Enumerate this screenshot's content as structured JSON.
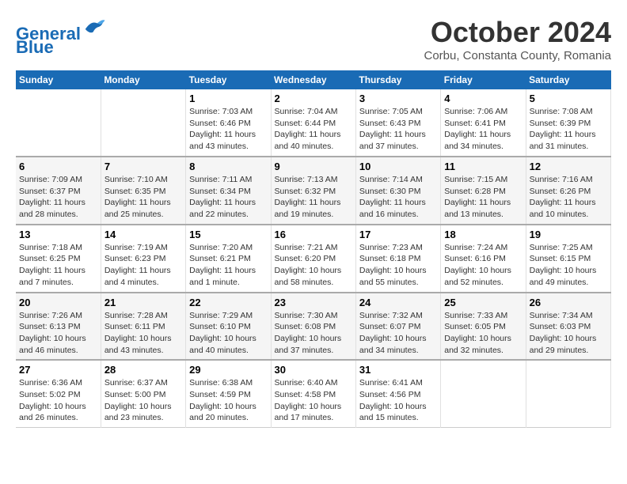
{
  "header": {
    "logo_line1": "General",
    "logo_line2": "Blue",
    "month": "October 2024",
    "location": "Corbu, Constanta County, Romania"
  },
  "columns": [
    "Sunday",
    "Monday",
    "Tuesday",
    "Wednesday",
    "Thursday",
    "Friday",
    "Saturday"
  ],
  "weeks": [
    [
      {
        "day": "",
        "info": ""
      },
      {
        "day": "",
        "info": ""
      },
      {
        "day": "1",
        "info": "Sunrise: 7:03 AM\nSunset: 6:46 PM\nDaylight: 11 hours and 43 minutes."
      },
      {
        "day": "2",
        "info": "Sunrise: 7:04 AM\nSunset: 6:44 PM\nDaylight: 11 hours and 40 minutes."
      },
      {
        "day": "3",
        "info": "Sunrise: 7:05 AM\nSunset: 6:43 PM\nDaylight: 11 hours and 37 minutes."
      },
      {
        "day": "4",
        "info": "Sunrise: 7:06 AM\nSunset: 6:41 PM\nDaylight: 11 hours and 34 minutes."
      },
      {
        "day": "5",
        "info": "Sunrise: 7:08 AM\nSunset: 6:39 PM\nDaylight: 11 hours and 31 minutes."
      }
    ],
    [
      {
        "day": "6",
        "info": "Sunrise: 7:09 AM\nSunset: 6:37 PM\nDaylight: 11 hours and 28 minutes."
      },
      {
        "day": "7",
        "info": "Sunrise: 7:10 AM\nSunset: 6:35 PM\nDaylight: 11 hours and 25 minutes."
      },
      {
        "day": "8",
        "info": "Sunrise: 7:11 AM\nSunset: 6:34 PM\nDaylight: 11 hours and 22 minutes."
      },
      {
        "day": "9",
        "info": "Sunrise: 7:13 AM\nSunset: 6:32 PM\nDaylight: 11 hours and 19 minutes."
      },
      {
        "day": "10",
        "info": "Sunrise: 7:14 AM\nSunset: 6:30 PM\nDaylight: 11 hours and 16 minutes."
      },
      {
        "day": "11",
        "info": "Sunrise: 7:15 AM\nSunset: 6:28 PM\nDaylight: 11 hours and 13 minutes."
      },
      {
        "day": "12",
        "info": "Sunrise: 7:16 AM\nSunset: 6:26 PM\nDaylight: 11 hours and 10 minutes."
      }
    ],
    [
      {
        "day": "13",
        "info": "Sunrise: 7:18 AM\nSunset: 6:25 PM\nDaylight: 11 hours and 7 minutes."
      },
      {
        "day": "14",
        "info": "Sunrise: 7:19 AM\nSunset: 6:23 PM\nDaylight: 11 hours and 4 minutes."
      },
      {
        "day": "15",
        "info": "Sunrise: 7:20 AM\nSunset: 6:21 PM\nDaylight: 11 hours and 1 minute."
      },
      {
        "day": "16",
        "info": "Sunrise: 7:21 AM\nSunset: 6:20 PM\nDaylight: 10 hours and 58 minutes."
      },
      {
        "day": "17",
        "info": "Sunrise: 7:23 AM\nSunset: 6:18 PM\nDaylight: 10 hours and 55 minutes."
      },
      {
        "day": "18",
        "info": "Sunrise: 7:24 AM\nSunset: 6:16 PM\nDaylight: 10 hours and 52 minutes."
      },
      {
        "day": "19",
        "info": "Sunrise: 7:25 AM\nSunset: 6:15 PM\nDaylight: 10 hours and 49 minutes."
      }
    ],
    [
      {
        "day": "20",
        "info": "Sunrise: 7:26 AM\nSunset: 6:13 PM\nDaylight: 10 hours and 46 minutes."
      },
      {
        "day": "21",
        "info": "Sunrise: 7:28 AM\nSunset: 6:11 PM\nDaylight: 10 hours and 43 minutes."
      },
      {
        "day": "22",
        "info": "Sunrise: 7:29 AM\nSunset: 6:10 PM\nDaylight: 10 hours and 40 minutes."
      },
      {
        "day": "23",
        "info": "Sunrise: 7:30 AM\nSunset: 6:08 PM\nDaylight: 10 hours and 37 minutes."
      },
      {
        "day": "24",
        "info": "Sunrise: 7:32 AM\nSunset: 6:07 PM\nDaylight: 10 hours and 34 minutes."
      },
      {
        "day": "25",
        "info": "Sunrise: 7:33 AM\nSunset: 6:05 PM\nDaylight: 10 hours and 32 minutes."
      },
      {
        "day": "26",
        "info": "Sunrise: 7:34 AM\nSunset: 6:03 PM\nDaylight: 10 hours and 29 minutes."
      }
    ],
    [
      {
        "day": "27",
        "info": "Sunrise: 6:36 AM\nSunset: 5:02 PM\nDaylight: 10 hours and 26 minutes."
      },
      {
        "day": "28",
        "info": "Sunrise: 6:37 AM\nSunset: 5:00 PM\nDaylight: 10 hours and 23 minutes."
      },
      {
        "day": "29",
        "info": "Sunrise: 6:38 AM\nSunset: 4:59 PM\nDaylight: 10 hours and 20 minutes."
      },
      {
        "day": "30",
        "info": "Sunrise: 6:40 AM\nSunset: 4:58 PM\nDaylight: 10 hours and 17 minutes."
      },
      {
        "day": "31",
        "info": "Sunrise: 6:41 AM\nSunset: 4:56 PM\nDaylight: 10 hours and 15 minutes."
      },
      {
        "day": "",
        "info": ""
      },
      {
        "day": "",
        "info": ""
      }
    ]
  ]
}
